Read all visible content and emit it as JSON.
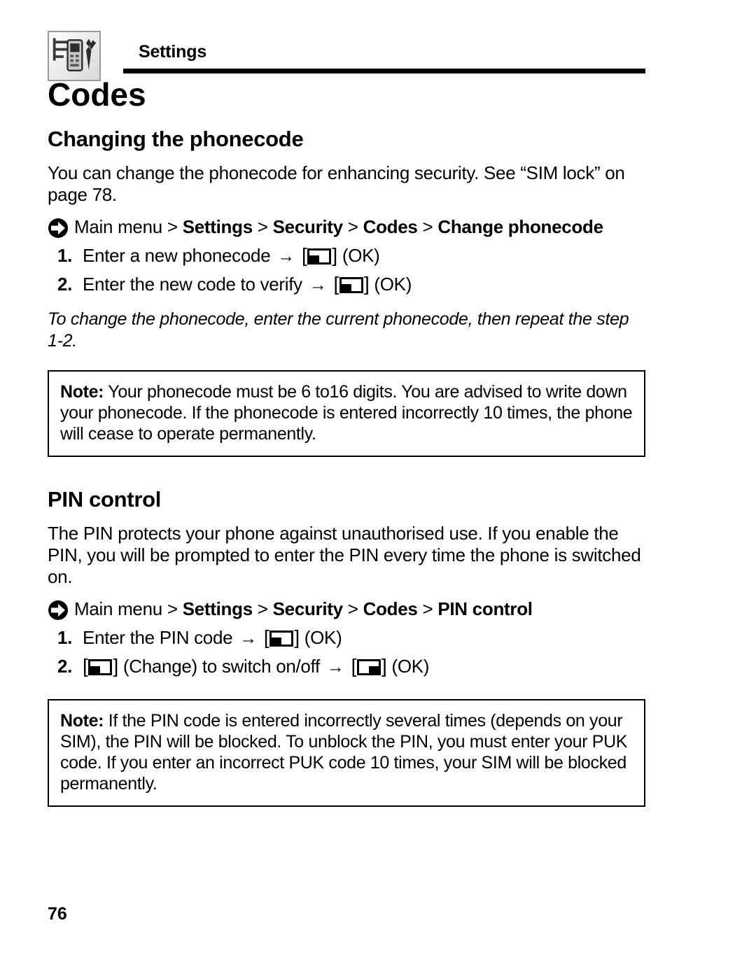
{
  "header": {
    "icon": "settings-tools-phone-icon",
    "title": "Settings"
  },
  "chapter": {
    "title": "Codes"
  },
  "page_number": "76",
  "sections": [
    {
      "heading": "Changing the phonecode",
      "body": "You can change the phonecode for enhancing security. See “SIM lock” on page 78.",
      "navpath": {
        "icon": "hook-arrow-icon",
        "prefix": "Main menu",
        "separator": ">",
        "items": [
          "Settings",
          "Security",
          "Codes",
          "Change phonecode"
        ],
        "line1": "Main menu > Settings > Security > Codes > Change",
        "line2": "phonecode"
      },
      "steps": [
        {
          "num": "1.",
          "pre": "Enter a new phonecode",
          "arrow": "→",
          "key": "softkey-left",
          "post": "(OK)"
        },
        {
          "num": "2.",
          "pre": "Enter the new code to verify",
          "arrow": "→",
          "key": "softkey-left",
          "post": "(OK)"
        }
      ],
      "italic_note": "To change the phonecode, enter the current phonecode, then repeat the step 1-2.",
      "note": {
        "label": "Note:",
        "text": " Your phonecode must be 6 to16 digits. You are advised to write down your phonecode. If the phonecode is entered incorrectly 10 times, the phone will cease to operate permanently."
      }
    },
    {
      "heading": "PIN control",
      "body": "The PIN protects your phone against unauthorised use. If you enable the PIN, you will be prompted to enter the PIN every time the phone is switched on.",
      "navpath": {
        "icon": "hook-arrow-icon",
        "prefix": "Main menu",
        "separator": ">",
        "items": [
          "Settings",
          "Security",
          "Codes",
          "PIN control"
        ],
        "line1": "Main menu > Settings > Security > Codes > PIN control",
        "line2": ""
      },
      "steps": [
        {
          "num": "1.",
          "pre": "Enter the PIN code",
          "arrow": "→",
          "key": "softkey-left",
          "post": "(OK)"
        },
        {
          "num": "2.",
          "leading_key": "softkey-left",
          "pre": "(Change) to switch on/off",
          "arrow": "→",
          "key": "softkey-right",
          "post": "(OK)"
        }
      ],
      "note": {
        "label": "Note:",
        "text": " If the PIN code is entered incorrectly several times (depends on your SIM), the PIN will be blocked. To unblock the PIN, you must enter your PUK code. If you enter an incorrect PUK code 10 times, your SIM will be blocked permanently."
      }
    }
  ]
}
